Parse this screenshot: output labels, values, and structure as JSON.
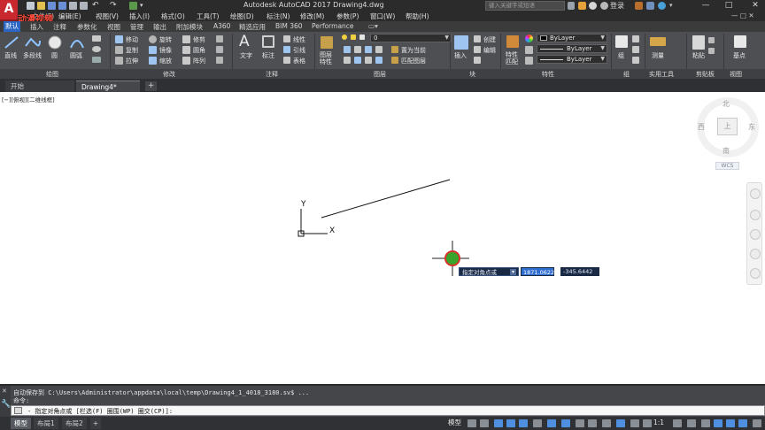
{
  "app": {
    "logo_letter": "A",
    "brand_overlay": "动漫视频",
    "window_title": "Autodesk AutoCAD 2017    Drawing4.dwg",
    "search_placeholder": "键入关键字或短语",
    "login_label": "登录",
    "window_controls": [
      "—",
      "□",
      "✕"
    ]
  },
  "menubar": {
    "items": [
      "文件(F)",
      "编辑(E)",
      "视图(V)",
      "插入(I)",
      "格式(O)",
      "工具(T)",
      "绘图(D)",
      "标注(N)",
      "修改(M)",
      "参数(P)",
      "窗口(W)",
      "帮助(H)"
    ]
  },
  "ribbon_tabs": [
    "默认",
    "插入",
    "注释",
    "参数化",
    "视图",
    "管理",
    "输出",
    "附加模块",
    "A360",
    "精选应用",
    "BIM 360",
    "Performance"
  ],
  "ribbon": {
    "draw": {
      "line": "直线",
      "polyline": "多段线",
      "circle": "圆",
      "arc": "圆弧"
    },
    "modify": {
      "move": "移动",
      "rotate": "旋转",
      "trim": "修剪",
      "copy": "复制",
      "mirror": "镜像",
      "fillet": "圆角",
      "stretch": "拉伸",
      "scale": "缩放",
      "array": "阵列"
    },
    "annotation": {
      "text": "文字",
      "dimension": "标注",
      "linear": "线性",
      "leader": "引线",
      "table": "表格"
    },
    "layers": {
      "layer_props": "图层特性",
      "layer_combo": "0",
      "set_current": "置为当前",
      "match_layer": "匹配图层"
    },
    "block": {
      "insert": "插入",
      "create": "创建",
      "edit": "编辑"
    },
    "properties": {
      "match": "特性匹配",
      "color": "ByLayer",
      "linetype": "ByLayer",
      "lineweight": "ByLayer"
    },
    "groups": {
      "group": "组"
    },
    "utilities": {
      "measure": "测量"
    },
    "clipboard": {
      "paste": "粘贴"
    },
    "view": {
      "base": "基点"
    },
    "panel_titles": [
      "绘图",
      "修改",
      "注释",
      "图层",
      "块",
      "特性",
      "组",
      "实用工具",
      "剪贴板",
      "视图"
    ]
  },
  "file_tabs": {
    "start": "开始",
    "drawing": "Drawing4*",
    "add": "+"
  },
  "viewport": {
    "label": "[−][俯视][二维线框]",
    "viewcube": {
      "north": "北",
      "south": "南",
      "east": "东",
      "west": "西",
      "top": "上",
      "wcs": "WCS"
    }
  },
  "dynamic_input": {
    "prompt": "指定对角点或",
    "x_value": "1871.0622",
    "y_value": "-345.6442"
  },
  "command": {
    "history_1": "自动保存到 C:\\Users\\Administrator\\appdata\\local\\temp\\Drawing4_1_4018_3180.sv$ ...",
    "history_2": "命令:",
    "input": "- 指定对角点或 [栏选(F) 圈围(WP) 圈交(CP)]:"
  },
  "layout_tabs": [
    "模型",
    "布局1",
    "布局2",
    "+"
  ],
  "status": {
    "model": "模型",
    "scale": "1:1"
  },
  "colors": {
    "titlebar": "#2b2b2b",
    "ribbon": "#4d4f52",
    "active_tab": "#2a66c2",
    "highlight_input": "#2f6ecf",
    "cursor_red": "#d8312a",
    "cursor_green": "#3aa32b"
  },
  "icons": [
    "autocad-logo-icon",
    "new-icon",
    "open-icon",
    "save-icon",
    "undo-icon",
    "redo-icon",
    "line-icon",
    "polyline-icon",
    "circle-icon",
    "arc-icon",
    "move-icon",
    "text-icon",
    "dimension-icon",
    "layer-icon",
    "insert-block-icon",
    "match-properties-icon",
    "group-icon",
    "measure-icon",
    "paste-icon",
    "base-point-icon",
    "ucs-icon",
    "crosshair-icon",
    "wrench-icon"
  ]
}
